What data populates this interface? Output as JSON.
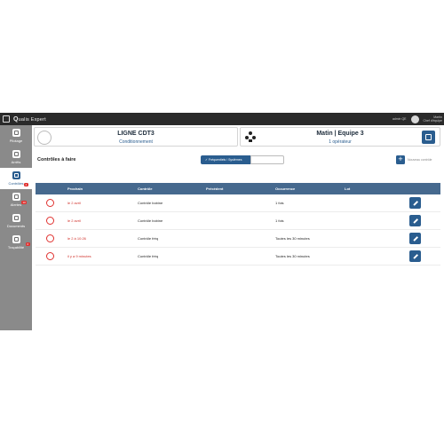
{
  "app": {
    "brand_q": "Q",
    "brand_rest": "ualis Expert",
    "user_label": "admin QE",
    "user_name": "Martin",
    "user_role": "Chef d'équipe"
  },
  "sidebar": {
    "items": [
      {
        "label": "Pilotage",
        "active": false,
        "badge": ""
      },
      {
        "label": "Arrêts",
        "active": false,
        "badge": ""
      },
      {
        "label": "Contrôles",
        "active": true,
        "badge": "4"
      },
      {
        "label": "Alertes",
        "active": false,
        "badge": "10"
      },
      {
        "label": "Documents",
        "active": false,
        "badge": ""
      },
      {
        "label": "Traçabilité",
        "active": false,
        "badge": "0"
      }
    ]
  },
  "header": {
    "line_title": "LIGNE CDT3",
    "line_sub": "Conditionnement",
    "team_title": "Matin | Equipe 3",
    "team_sub": "1 opérateur"
  },
  "controls": {
    "title": "Contrôles à faire",
    "filter_active": "✓ Fréquentiels / Systèmes",
    "filter_inactive": "",
    "add_label": "Nouveau contrôle",
    "columns": [
      "Prochain",
      "Contrôle",
      "Précédent",
      "Occurrence",
      "Lot"
    ],
    "rows": [
      {
        "next": "le 2 avril",
        "control": "Contrôle bobine",
        "previous": "",
        "occurrence": "1 fois",
        "lot": ""
      },
      {
        "next": "le 2 avril",
        "control": "Contrôle bobine",
        "previous": "",
        "occurrence": "1 fois",
        "lot": ""
      },
      {
        "next": "le 2 à 10:26",
        "control": "Contrôle fréq",
        "previous": "",
        "occurrence": "Toutes les 30 minutes",
        "lot": ""
      },
      {
        "next": "il y a 9 minutes",
        "control": "Contrôle fréq",
        "previous": "",
        "occurrence": "Toutes les 30 minutes",
        "lot": ""
      }
    ]
  },
  "colors": {
    "accent": "#2a5d8f",
    "table_header": "#46698e",
    "alert": "#e0312f",
    "sidebar": "#8a8a8a",
    "topbar": "#2a2a2a"
  }
}
